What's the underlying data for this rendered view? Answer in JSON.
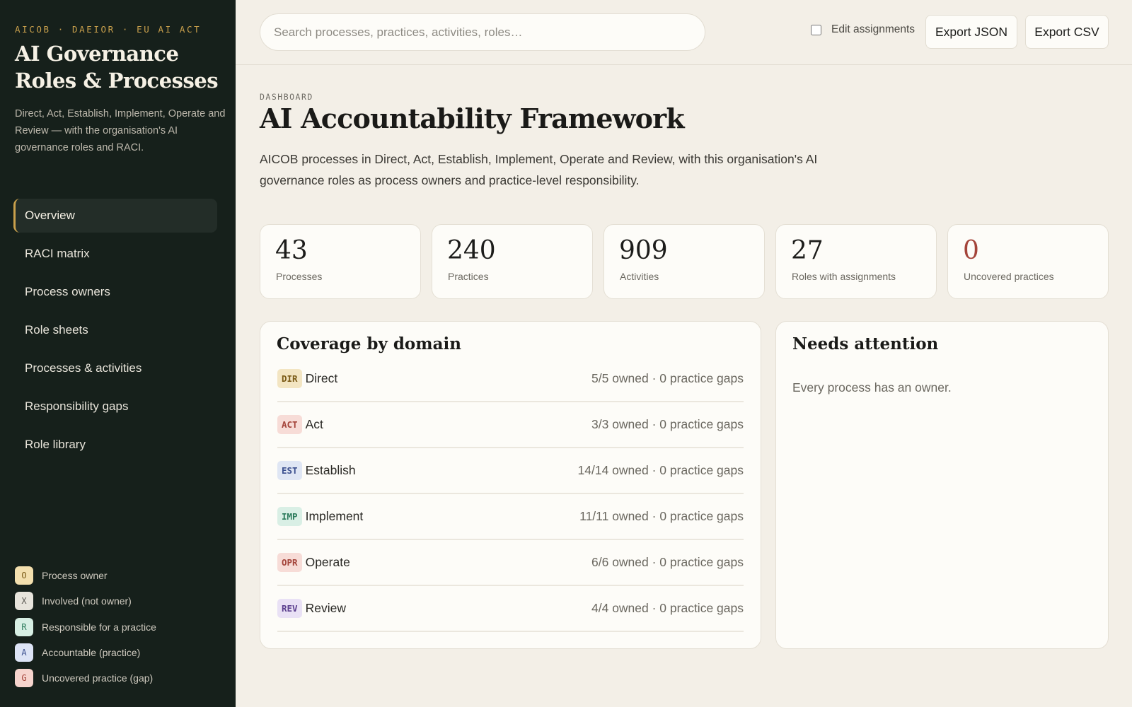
{
  "sidebar": {
    "kicker": "AICOB · DAEIOR · EU AI ACT",
    "title": "AI Governance Roles & Processes",
    "description": "Direct, Act, Establish, Implement, Operate and Review — with the organisation's AI governance roles and RACI.",
    "nav": [
      {
        "label": "Overview",
        "active": true
      },
      {
        "label": "RACI matrix"
      },
      {
        "label": "Process owners"
      },
      {
        "label": "Role sheets"
      },
      {
        "label": "Processes & activities"
      },
      {
        "label": "Responsibility gaps"
      },
      {
        "label": "Role library"
      }
    ],
    "legend": [
      {
        "badge": "O",
        "label": "Process owner"
      },
      {
        "badge": "X",
        "label": "Involved (not owner)"
      },
      {
        "badge": "R",
        "label": "Responsible for a practice"
      },
      {
        "badge": "A",
        "label": "Accountable (practice)"
      },
      {
        "badge": "G",
        "label": "Uncovered practice (gap)"
      }
    ]
  },
  "topbar": {
    "search_placeholder": "Search processes, practices, activities, roles…",
    "edit_label": "Edit assignments",
    "export_json": "Export JSON",
    "export_csv": "Export CSV"
  },
  "main": {
    "eyebrow": "DASHBOARD",
    "title": "AI Accountability Framework",
    "description": "AICOB processes in Direct, Act, Establish, Implement, Operate and Review, with this organisation's AI governance roles as process owners and practice-level responsibility.",
    "stats": [
      {
        "value": "43",
        "label": "Processes"
      },
      {
        "value": "240",
        "label": "Practices"
      },
      {
        "value": "909",
        "label": "Activities"
      },
      {
        "value": "27",
        "label": "Roles with assignments"
      },
      {
        "value": "0",
        "label": "Uncovered practices",
        "color": "#a4443a"
      }
    ],
    "coverage": {
      "title": "Coverage by domain",
      "rows": [
        {
          "code": "DIR",
          "name": "Direct",
          "status": "5/5 owned · 0 practice gaps"
        },
        {
          "code": "ACT",
          "name": "Act",
          "status": "3/3 owned · 0 practice gaps"
        },
        {
          "code": "EST",
          "name": "Establish",
          "status": "14/14 owned · 0 practice gaps"
        },
        {
          "code": "IMP",
          "name": "Implement",
          "status": "11/11 owned · 0 practice gaps"
        },
        {
          "code": "OPR",
          "name": "Operate",
          "status": "6/6 owned · 0 practice gaps"
        },
        {
          "code": "REV",
          "name": "Review",
          "status": "4/4 owned · 0 practice gaps"
        }
      ]
    },
    "attention": {
      "title": "Needs attention",
      "message": "Every process has an owner."
    }
  },
  "colors": {
    "sidebar_bg": "#16201b",
    "accent_gold": "#c9a04c",
    "page_bg": "#f3efe7",
    "warning": "#a4443a"
  }
}
